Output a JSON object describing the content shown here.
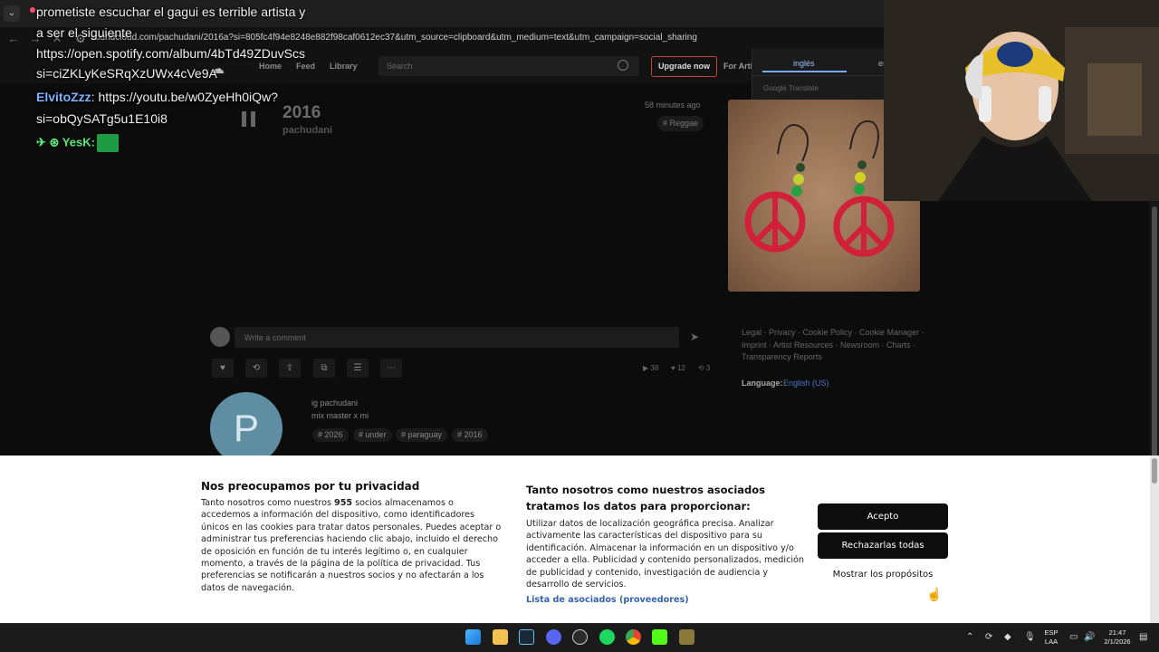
{
  "browser": {
    "url": "soundcloud.com/pachudani/2016a?si=805fc4f94e8248e882f98caf0612ec37&utm_source=clipboard&utm_medium=text&utm_campaign=social_sharing",
    "chevron": "⌄"
  },
  "header": {
    "nav": [
      "Home",
      "Feed",
      "Library"
    ],
    "search_placeholder": "Search",
    "upgrade_label": "Upgrade now",
    "for_artists_label": "For Arti"
  },
  "translate": {
    "lang_selected": "inglés",
    "lang_other": "es",
    "brand": "Google Translate"
  },
  "chat": {
    "line1": "prometiste escuchar el gagui es terrible artista y",
    "line2": "a ser el siguiente",
    "line3": "https://open.spotify.com/album/4bTd49ZDuvScs",
    "line4": "si=ciZKLyKeSRqXzUWx4cVe9A",
    "user2": "ElvitoZzz",
    "line5": ": https://youtu.be/w0ZyeHh0iQw?",
    "line6": "si=obQySATg5u1E10i8",
    "user3": "YesK:",
    "emotes": "✈ ⊛"
  },
  "track": {
    "title": "2016",
    "artist": "pachudani",
    "posted": "58 minutes ago",
    "genre_tag": "# Reggae"
  },
  "comment": {
    "placeholder": "Write a comment"
  },
  "actions": [
    "♥",
    "⟲",
    "⇪",
    "⧉",
    "☰",
    "⋯"
  ],
  "stats": {
    "plays": "▶ 38",
    "likes": "♥ 12",
    "reposts": "⟲ 3"
  },
  "profile": {
    "avatar_letter": "P",
    "desc1": "ig pachudani",
    "desc2": "mix master x mi",
    "tags": [
      "# 2026",
      "# under",
      "# paraguay",
      "# 2016"
    ]
  },
  "footer": {
    "links": "Legal · Privacy · Cookie Policy · Cookie Manager · Imprint · Artist Resources · Newsroom · Charts · Transparency Reports",
    "language_label": "Language:",
    "language_value": "English (US)"
  },
  "consent": {
    "title": "Nos preocupamos por tu privacidad",
    "body_a": "Tanto nosotros como nuestros ",
    "partners_count": "955",
    "body_b": " socios almacenamos o accedemos a información del dispositivo, como identificadores únicos en las cookies para tratar datos personales. Puedes aceptar o administrar tus preferencias haciendo clic abajo, incluido el derecho de oposición en función de tu interés legítimo o, en cualquier momento, a través de la página de la política de privacidad. Tus preferencias se notificarán a nuestros socios y no afectarán a los datos de navegación.",
    "title2": "Tanto nosotros como nuestros asociados tratamos los datos para proporcionar:",
    "body2": "Utilizar datos de localización geográfica precisa. Analizar activamente las características del dispositivo para su identificación. Almacenar la información en un dispositivo y/o acceder a ella. Publicidad y contenido personalizados, medición de publicidad y contenido, investigación de audiencia y desarrollo de servicios.",
    "partners_link": "Lista de asociados (proveedores)",
    "accept": "Acepto",
    "reject": "Rechazarlas todas",
    "purposes": "Mostrar los propósitos"
  },
  "taskbar": {
    "lang1": "ESP",
    "lang2": "LAA",
    "time": "21:47",
    "date": "2/1/2026"
  },
  "colors": {
    "accent_upgrade": "#c14a2a",
    "link_blue": "#4a76c8",
    "avatar_blue": "#5f8ea2"
  }
}
